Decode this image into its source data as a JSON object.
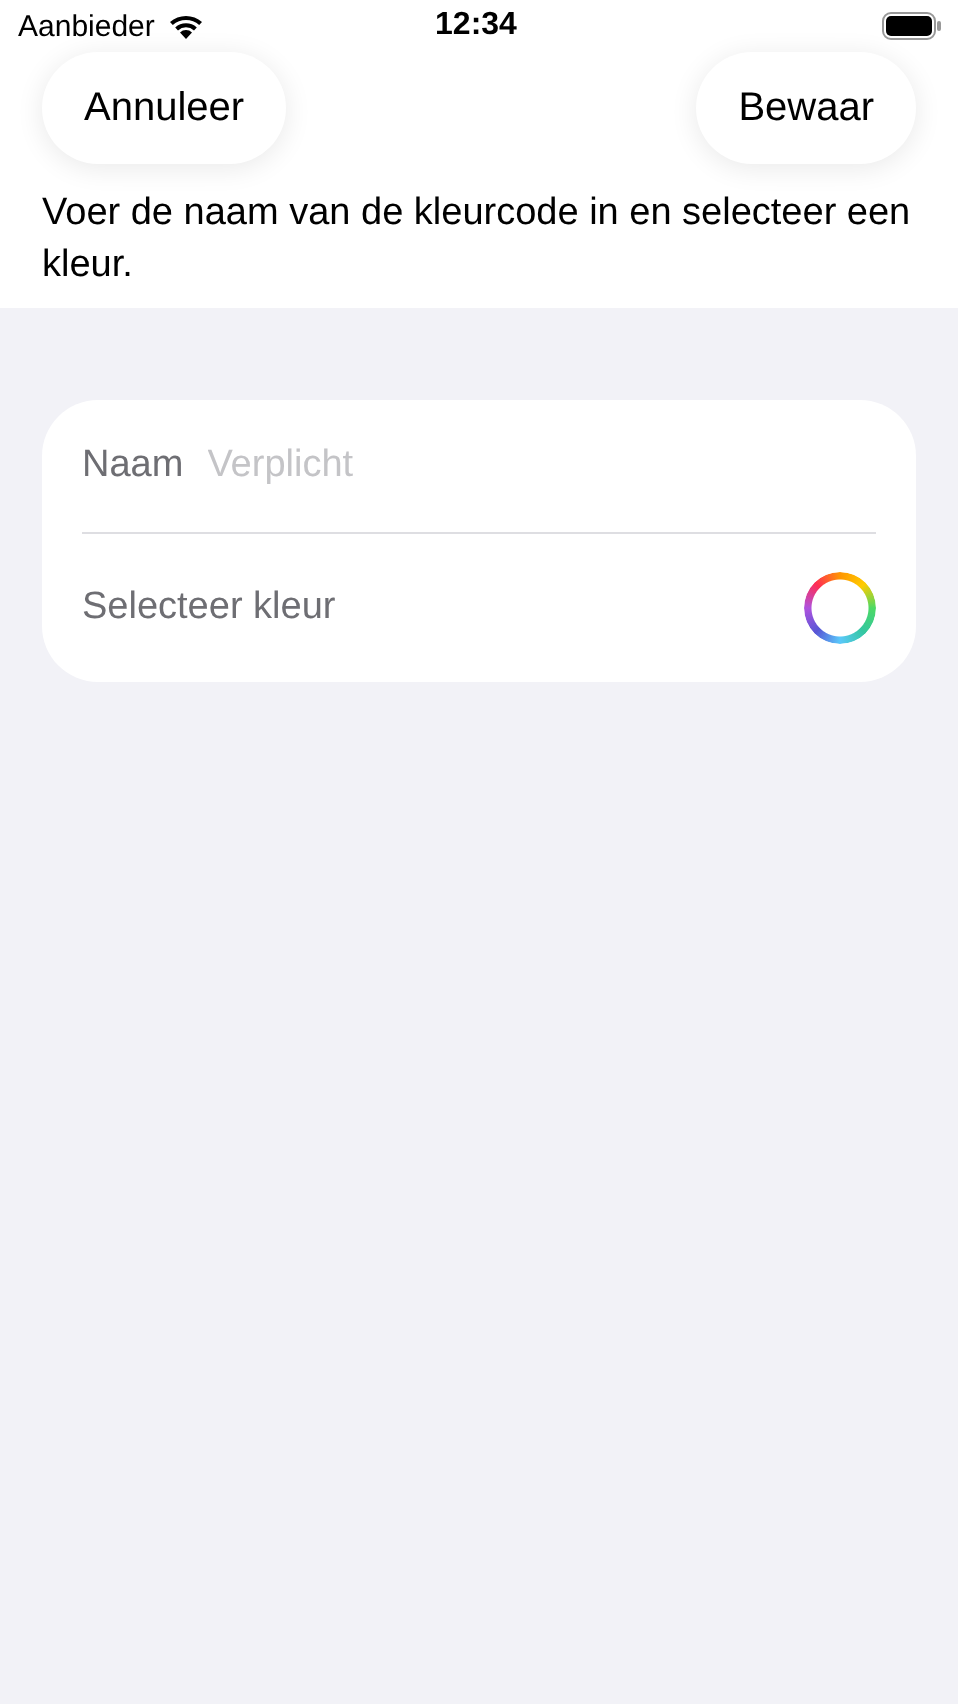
{
  "status_bar": {
    "carrier": "Aanbieder",
    "time": "12:34"
  },
  "nav": {
    "cancel": "Annuleer",
    "save": "Bewaar"
  },
  "description": "Voer de naam van de kleurcode in en selecteer een kleur.",
  "form": {
    "name_label": "Naam",
    "name_placeholder": "Verplicht",
    "color_label": "Selecteer kleur"
  }
}
